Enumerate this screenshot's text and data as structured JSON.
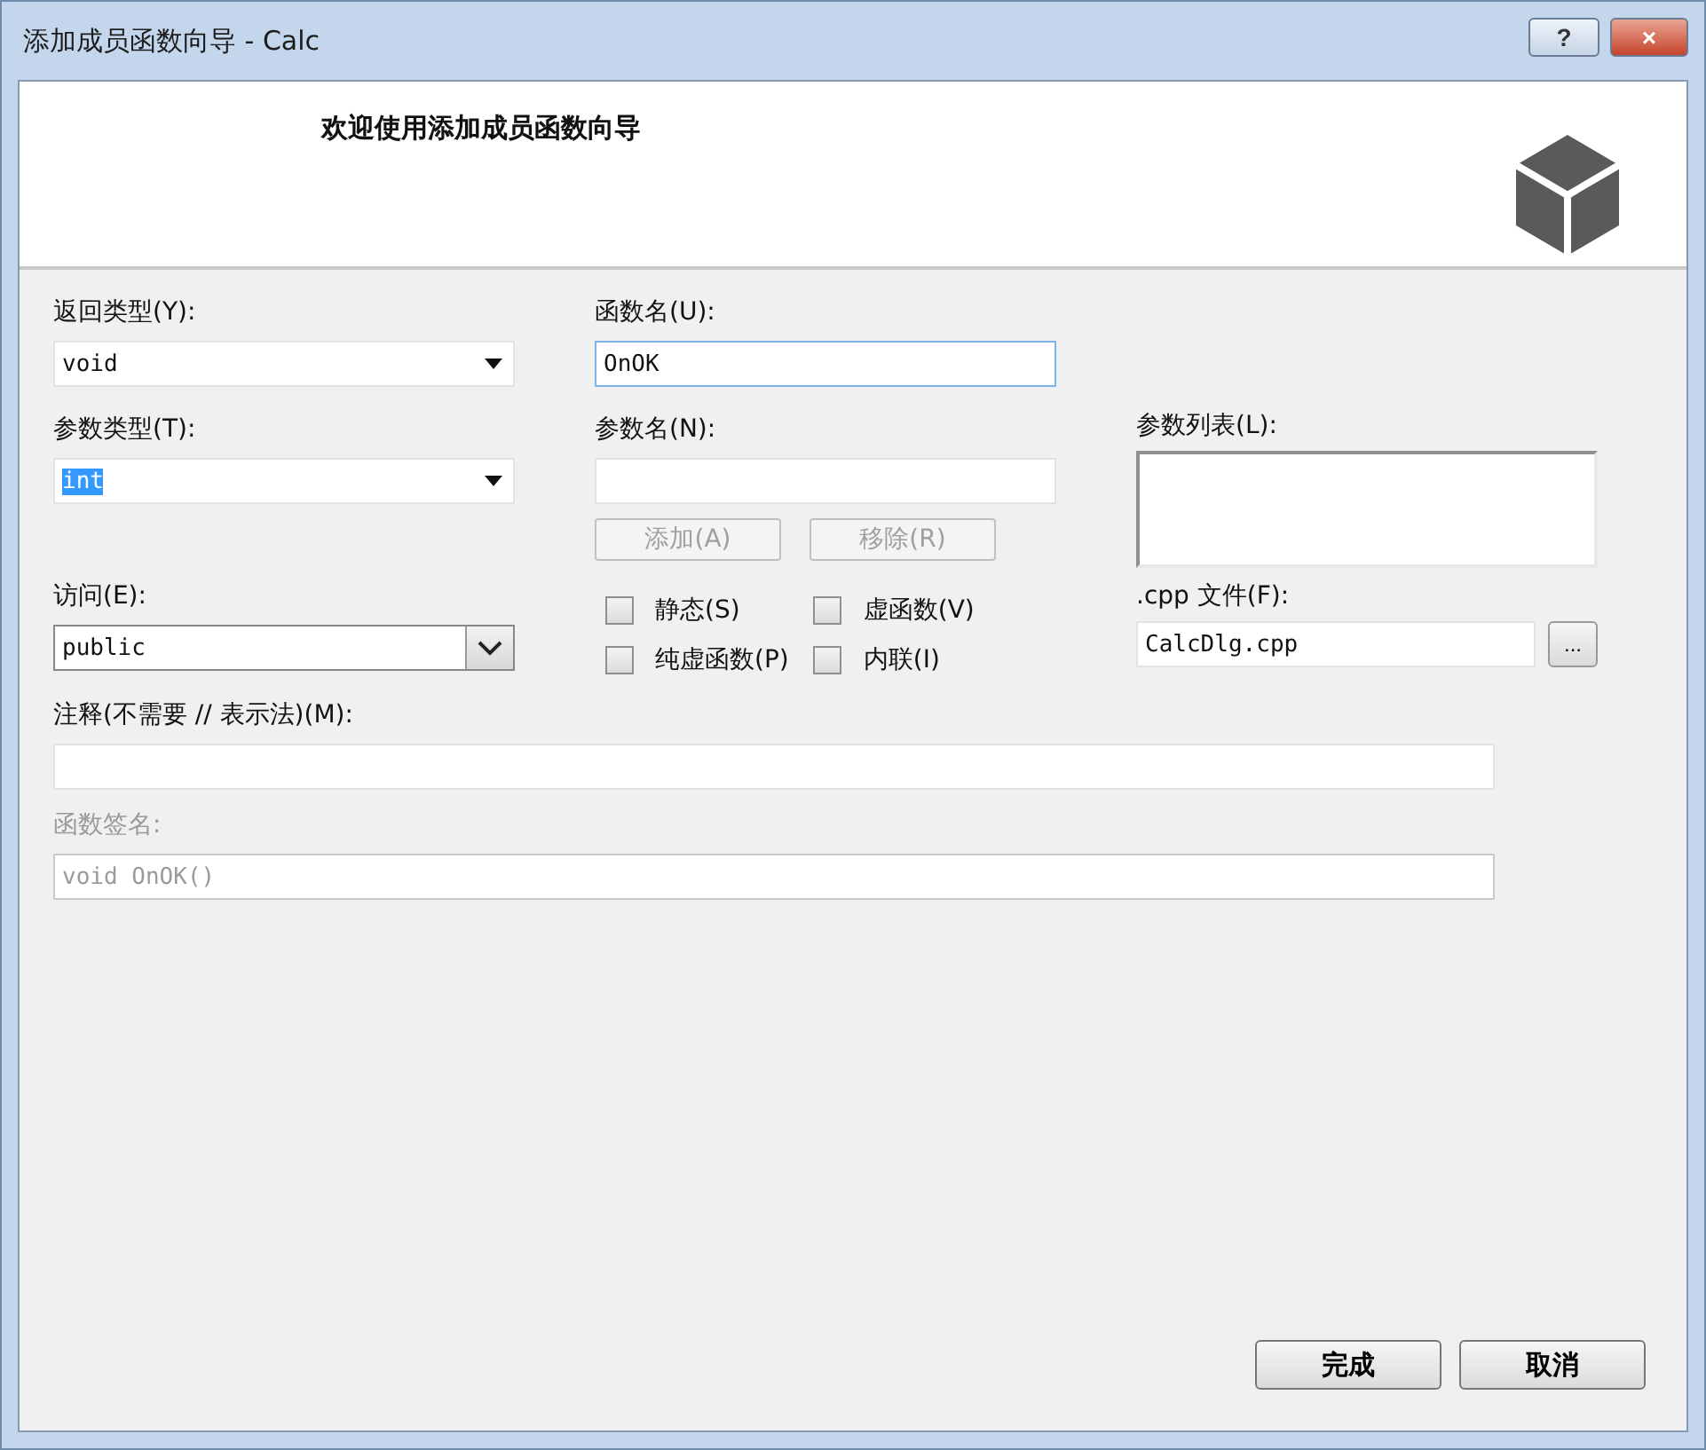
{
  "window": {
    "title": "添加成员函数向导 - Calc",
    "help": "?",
    "close": "×"
  },
  "header": {
    "title": "欢迎使用添加成员函数向导"
  },
  "return_type": {
    "label": "返回类型(Y):",
    "value": "void"
  },
  "function_name": {
    "label": "函数名(U):",
    "value": "OnOK",
    "focused": true
  },
  "param_type": {
    "label": "参数类型(T):",
    "value": "int",
    "highlighted": true
  },
  "param_name": {
    "label": "参数名(N):"
  },
  "param_buttons": [
    {
      "label": "添加(A)",
      "disabled": true
    },
    {
      "label": "移除(R)",
      "disabled": true
    }
  ],
  "param_list": {
    "label": "参数列表(L):"
  },
  "access": {
    "label": "访问(E):",
    "value": "public"
  },
  "checkboxes": [
    {
      "label": "静态(S)",
      "checked": false
    },
    {
      "label": "虚函数(V)",
      "checked": false
    },
    {
      "label": "纯虚函数(P)",
      "checked": false
    },
    {
      "label": "内联(I)",
      "checked": false
    }
  ],
  "cpp_file": {
    "label": ".cpp 文件(F):",
    "value": "CalcDlg.cpp",
    "browse": "..."
  },
  "comment": {
    "label": "注释(不需要 // 表示法)(M):"
  },
  "signature": {
    "label": "函数签名:",
    "value": "void OnOK()",
    "disabled": true
  },
  "buttons": [
    {
      "label": "完成"
    },
    {
      "label": "取消"
    }
  ]
}
